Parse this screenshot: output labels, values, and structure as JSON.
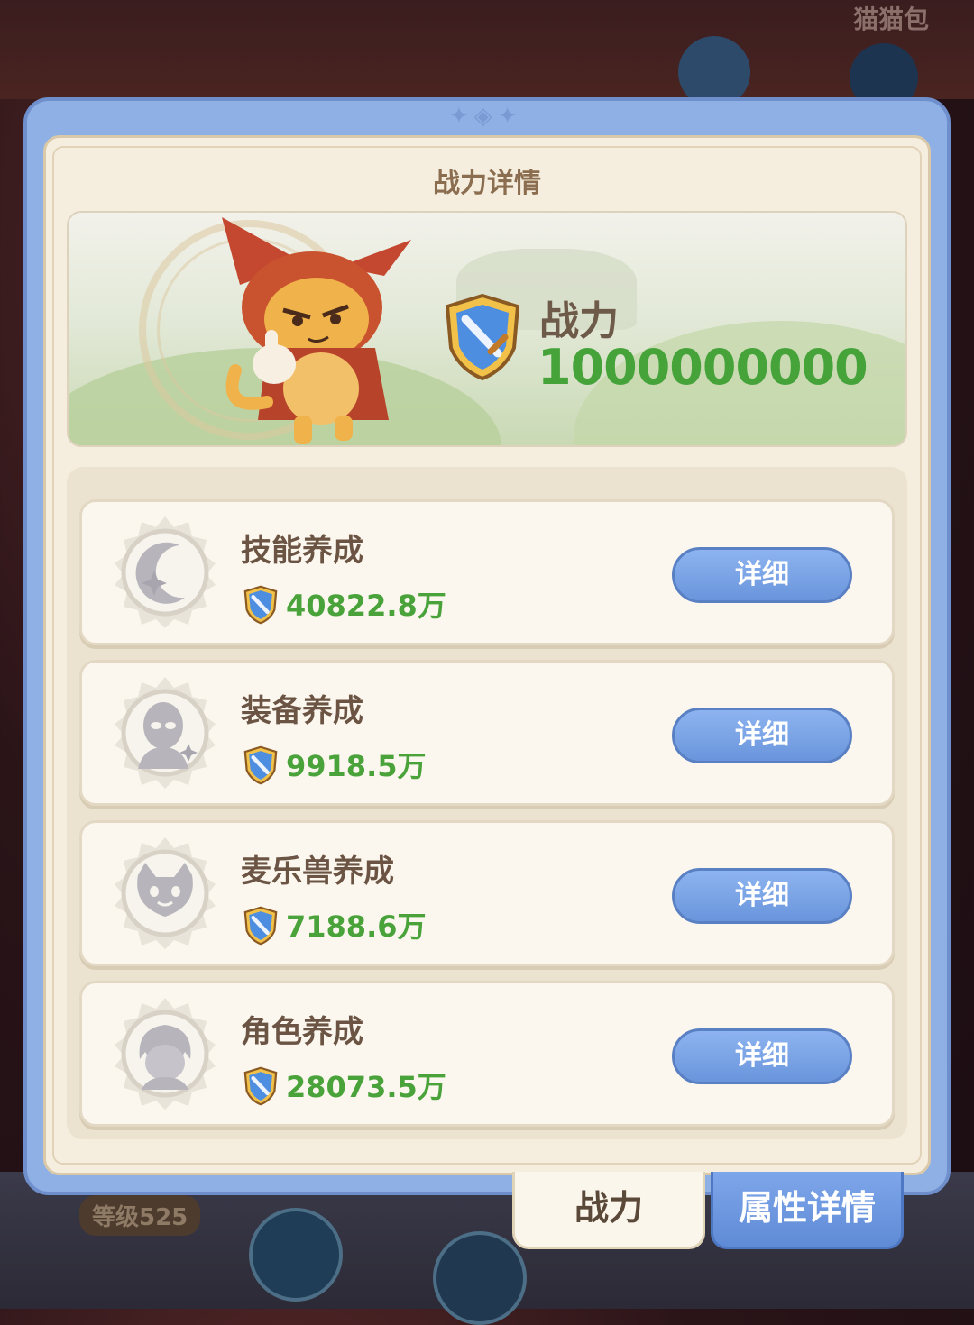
{
  "background": {
    "top_label": "猫猫包",
    "level_badge": "等级525"
  },
  "panel": {
    "title": "战力详情",
    "power": {
      "label": "战力",
      "value": "1000000000"
    },
    "categories": [
      {
        "name": "技能养成",
        "value": "40822.8万",
        "button": "详细",
        "icon": "moon-sparkle-icon"
      },
      {
        "name": "装备养成",
        "value": "9918.5万",
        "button": "详细",
        "icon": "alien-head-icon"
      },
      {
        "name": "麦乐兽养成",
        "value": "7188.6万",
        "button": "详细",
        "icon": "cat-face-icon"
      },
      {
        "name": "角色养成",
        "value": "28073.5万",
        "button": "详细",
        "icon": "hair-head-icon"
      }
    ]
  },
  "tabs": {
    "active": "战力",
    "inactive": "属性详情"
  },
  "colors": {
    "accent_blue": "#7ea6ea",
    "power_green": "#45a33a",
    "panel_cream": "#f5eedf"
  }
}
